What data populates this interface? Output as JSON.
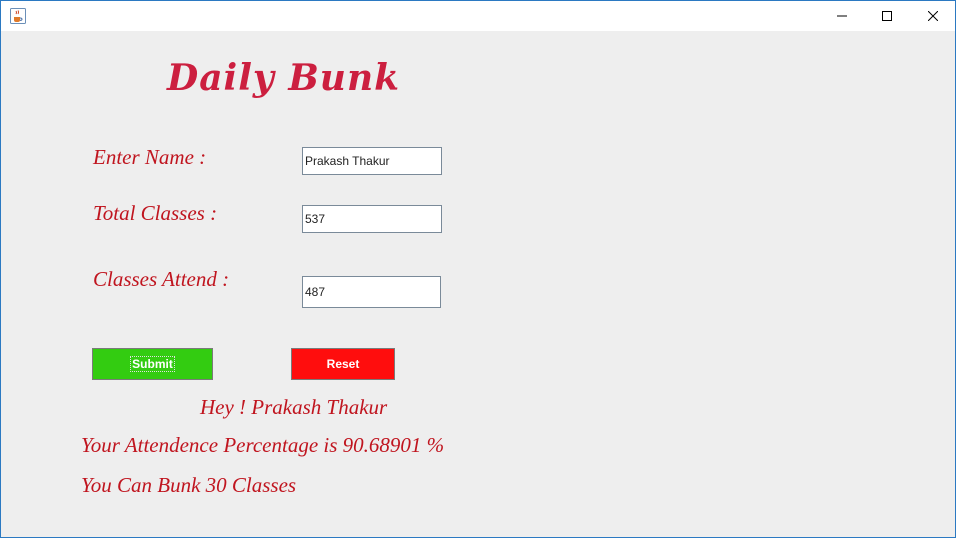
{
  "titlebar": {
    "app_icon": "java-coffee-cup-icon",
    "controls": [
      "minimize-icon",
      "maximize-icon",
      "close-icon"
    ]
  },
  "app": {
    "title": "Daily Bunk"
  },
  "form": {
    "name_label": "Enter Name :",
    "name_value": "Prakash Thakur",
    "total_label": "Total Classes :",
    "total_value": "537",
    "attend_label": "Classes Attend :",
    "attend_value": "487"
  },
  "buttons": {
    "submit_label": "Submit",
    "submit_color": "#33cc11",
    "reset_label": "Reset",
    "reset_color": "#ff0d0d"
  },
  "result": {
    "greeting": "Hey ! Prakash Thakur",
    "percentage": "Your Attendence Percentage is 90.68901 %",
    "bunk": "You Can Bunk 30 Classes"
  },
  "colors": {
    "accent_text": "#c0151f",
    "title_text": "#cc1f3f",
    "background": "#eeeeee"
  }
}
